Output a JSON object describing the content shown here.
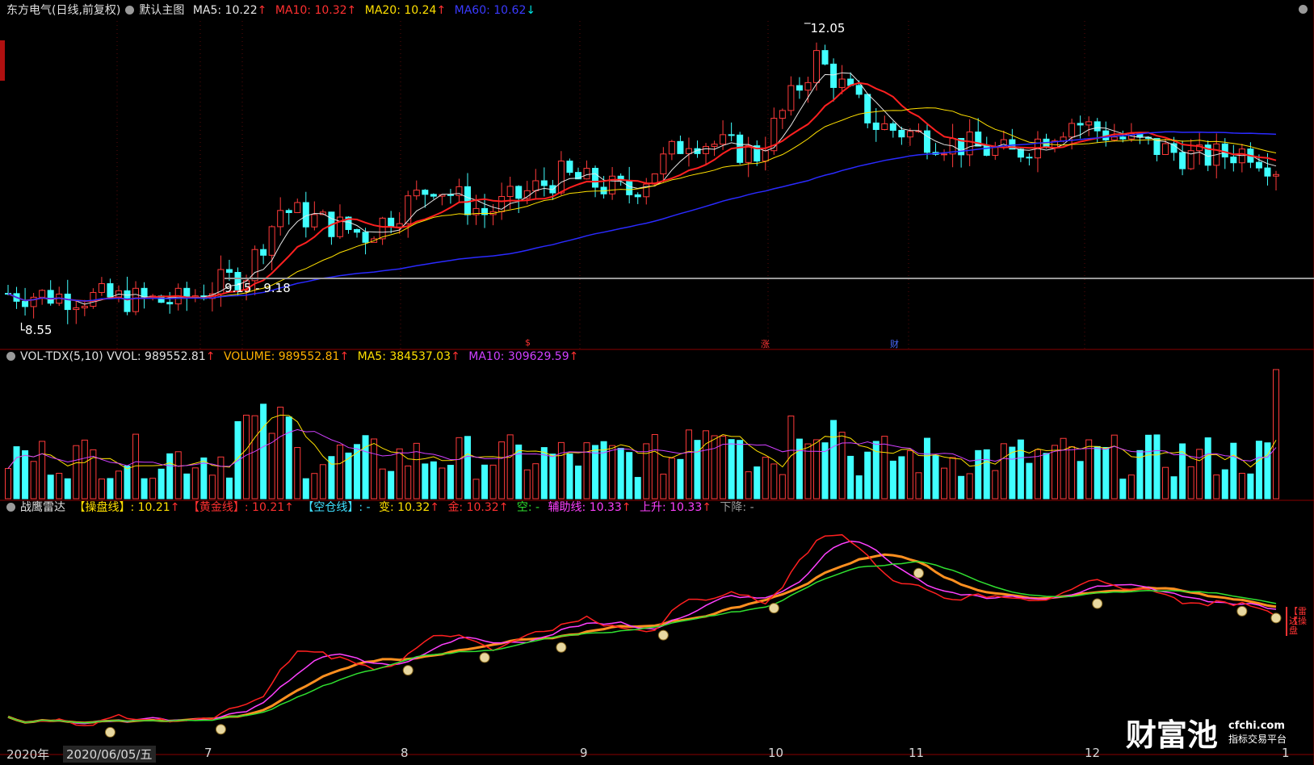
{
  "main_pane": {
    "stock": "东方电气(日线,前复权)",
    "template": "默认主图",
    "ma5": {
      "label": "MA5: 10.22",
      "arrow": "↑",
      "color": "#e6e6e6"
    },
    "ma10": {
      "label": "MA10: 10.32",
      "arrow": "↑",
      "color": "#ff3030"
    },
    "ma20": {
      "label": "MA20: 10.24",
      "arrow": "↑",
      "color": "#ffe000"
    },
    "ma60": {
      "label": "MA60: 10.62",
      "arrow": "↓",
      "color": "#2a2aff"
    },
    "high_label": "12.05",
    "low_label": "8.55",
    "range_label": "9.15 - 9.18",
    "markers": [
      "$",
      "涨",
      "财"
    ]
  },
  "volume_pane": {
    "title": "VOL-TDX(5,10) VVOL: 989552.81",
    "title_arrow": "↑",
    "volume": "VOLUME: 989552.81",
    "volume_arrow": "↑",
    "ma5": "MA5: 384537.03",
    "ma5_arrow": "↑",
    "ma10": "MA10: 309629.59",
    "ma10_arrow": "↑"
  },
  "indicator_pane": {
    "name": "战鹰雷达",
    "line1_label": "【操盘线】",
    "line1_value": ": 10.21",
    "line1_arrow": "↑",
    "line2_label": "【黄金线】",
    "line2_value": ": 10.21",
    "line2_arrow": "↑",
    "line3_label": "【空仓线】",
    "line3_value": ": -",
    "bian": "变: 10.32",
    "bian_arrow": "↑",
    "jin": "金: 10.32",
    "jin_arrow": "↑",
    "kong": "空: -",
    "fuzhu": "辅助线: 10.33",
    "fuzhu_arrow": "↑",
    "shangsheng": "上升: 10.33",
    "shangsheng_arrow": "↑",
    "xiajiang": "下降: -",
    "right_tags": [
      "【雷达",
      "【操盘"
    ]
  },
  "x_axis": {
    "year": "2020年",
    "cursor_date": "2020/06/05/五",
    "months": [
      "7",
      "8",
      "9",
      "10",
      "11",
      "12",
      "1"
    ]
  },
  "branding": {
    "name": "财富池",
    "domain": "cfchi.com",
    "slogan": "指标交易平台"
  }
}
